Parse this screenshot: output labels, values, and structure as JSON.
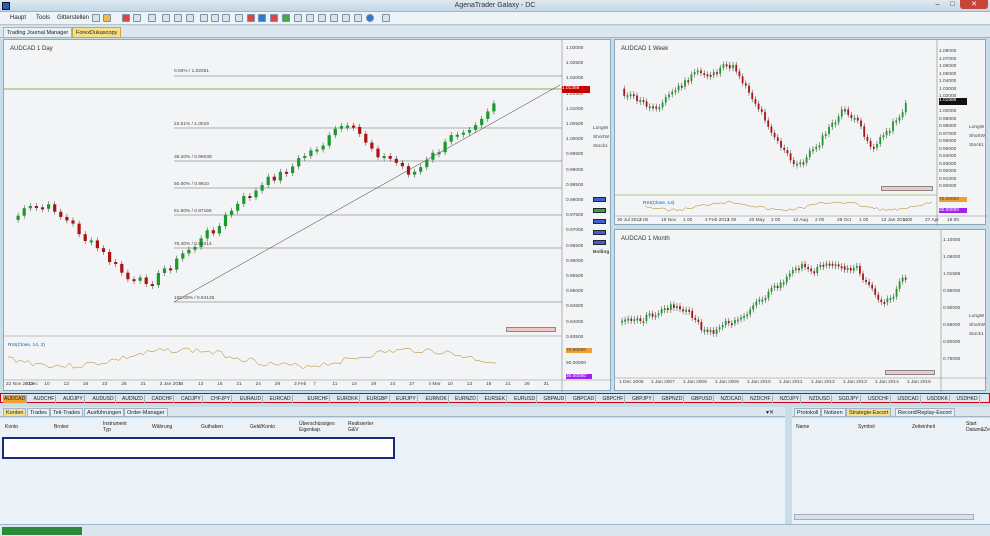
{
  "window": {
    "title": "AgenaTrader Galaxy - DC"
  },
  "menu": [
    "Haupt",
    "Tools",
    "Gitterstellen"
  ],
  "doc_tabs": [
    "Trading Journal Manager",
    "ForexDukascopy"
  ],
  "charts": {
    "daily": {
      "label": "AUDCAD 1 Day",
      "price_current": "1.01356",
      "yticks": [
        "1.03000",
        "1.02500",
        "1.02000",
        "1.01500",
        "1.01000",
        "1.00500",
        "1.00000",
        "0.99500",
        "0.99000",
        "0.98500",
        "0.98000",
        "0.97500",
        "0.97000",
        "0.96500",
        "0.96000",
        "0.95500",
        "0.95000",
        "0.94500",
        "0.94000",
        "0.93500"
      ],
      "xticks": [
        "22 Nov 2013",
        "4 Dec",
        "10",
        "13",
        "18",
        "23",
        "28",
        "31",
        "3 Jan 2014",
        "8",
        "13",
        "16",
        "21",
        "24",
        "29",
        "3 Feb",
        "7",
        "11",
        "14",
        "19",
        "24",
        "27",
        "4 Mar",
        "10",
        "13",
        "18",
        "21",
        "26",
        "31"
      ],
      "fib": [
        "0.00% / 1.02061",
        "23.61% / 1.0019",
        "38.20% / 0.99038",
        "50.00% / 0.9810",
        "61.80% / 0.97166",
        "76.40% / 0.96014",
        "100.00% / 0.94125"
      ],
      "rsi_label": "RSI(Close, 14, 3)",
      "rsi_vals": [
        "70.00000",
        "50.00000",
        "30.00000"
      ],
      "side_labels": [
        "LongW",
        "ShortW",
        "Stock1"
      ],
      "bolling": "Bolling"
    },
    "weekly": {
      "label": "AUDCAD 1 Week",
      "price_current": "1.01586",
      "yticks": [
        "1.08000",
        "1.07000",
        "1.06000",
        "1.05000",
        "1.04000",
        "1.03000",
        "1.02000",
        "1.01000",
        "1.00000",
        "0.99000",
        "0.98000",
        "0.97000",
        "0.96000",
        "0.95000",
        "0.94000",
        "0.93000",
        "0.92000",
        "0.91000",
        "0.90000"
      ],
      "xticks": [
        "30 Jul 2012",
        "2 00",
        "19 Nov",
        "1 00",
        "4 Feb 2013",
        "1 00",
        "20 May",
        "2 00",
        "12 Aug",
        "2 00",
        "28 Oct",
        "1 00",
        "13 Jan 2014",
        "1 00",
        "27 Apr",
        "19 00"
      ],
      "side_labels": [
        "LongW",
        "ShortW",
        "Stock1"
      ],
      "rsi_label": "RSI(Close, 14)",
      "rsi_vals": [
        "70.00000",
        "30.00000"
      ]
    },
    "monthly": {
      "label": "AUDCAD 1 Month",
      "price_current": "1.01586",
      "yticks": [
        "1.10000",
        "1.06000",
        "1.01586",
        "0.96000",
        "0.90000",
        "0.86000",
        "0.80000",
        "0.76000"
      ],
      "xticks": [
        "1 Dec 2006",
        "1 Jan 2007",
        "1 Jan 2008",
        "1 Jan 2009",
        "1 Jan 2010",
        "1 Jan 2011",
        "1 Jan 2012",
        "1 Jan 2013",
        "1 Jan 2014",
        "1 Jan 2015"
      ],
      "side_labels": [
        "LongW",
        "ShortW",
        "Stock1"
      ]
    }
  },
  "instruments": [
    "AUDCAD",
    "AUDCHF",
    "AUDJPY",
    "AUDUSD",
    "AUDNZD",
    "CADCHF",
    "CADJPY",
    "CHFJPY",
    "EURAUD",
    "EURCAD",
    "EURCHF",
    "EURDKK",
    "EURGBP",
    "EURJPY",
    "EURNOK",
    "EURNZD",
    "EURSEK",
    "EURUSD",
    "GBPAUD",
    "GBPCAD",
    "GBPCHF",
    "GBPJPY",
    "GBPNZD",
    "GBPUSD",
    "NZDCAD",
    "NZDCHF",
    "NZDJPY",
    "NZDUSD",
    "SGDJPY",
    "USDCHF",
    "USDCAD",
    "USDDKK",
    "USDHKD"
  ],
  "bottom_tabs": [
    "Konten",
    "Trades",
    "Teil-Trades",
    "Ausführungen",
    "Order-Manager"
  ],
  "account_columns": [
    "Konto",
    "Broker",
    "Instrument Typ",
    "Währung",
    "Guthaben",
    "Geld/Konto",
    "Überschüssiges Eigenkap.",
    "Realisierter G&V"
  ],
  "right_tabs": [
    "Protokoll",
    "Notizen",
    "Strategie-Escort",
    "Record/Replay-Escort"
  ],
  "right_columns": [
    "Name",
    "Symbol",
    "Zeiteinheit",
    "Start Datum&Zeit"
  ]
}
